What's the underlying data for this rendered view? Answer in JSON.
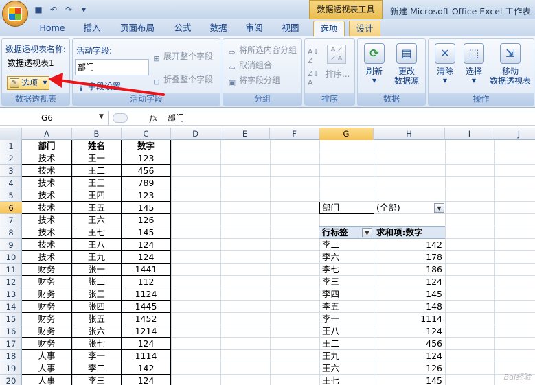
{
  "titlebar": {
    "context_tool": "数据透视表工具",
    "window_title": "新建 Microsoft Office Excel 工作表 -"
  },
  "tabs": [
    "Home",
    "插入",
    "页面布局",
    "公式",
    "数据",
    "审阅",
    "视图",
    "选项",
    "设计"
  ],
  "active_tab": "选项",
  "ribbon": {
    "pivot_group": {
      "name_label": "数据透视表名称:",
      "name_value": "数据透视表1",
      "options_btn": "选项",
      "group_label": "数据透视表"
    },
    "active_field_group": {
      "label": "活动字段:",
      "value": "部门",
      "field_settings": "字段设置",
      "expand": "展开整个字段",
      "collapse": "折叠整个字段",
      "group_label": "活动字段"
    },
    "group_group": {
      "group_selection": "将所选内容分组",
      "ungroup": "取消组合",
      "group_field": "将字段分组",
      "group_label": "分组"
    },
    "sort_group": {
      "sort": "排序...",
      "group_label": "排序"
    },
    "data_group": {
      "refresh": "刷新",
      "change_source_1": "更改",
      "change_source_2": "数据源",
      "group_label": "数据"
    },
    "actions_group": {
      "clear": "清除",
      "select": "选择",
      "move_1": "移动",
      "move_2": "数据透视表",
      "group_label": "操作"
    }
  },
  "formula_bar": {
    "cell_ref": "G6",
    "fx": "fx",
    "value": "部门"
  },
  "grid": {
    "columns": [
      "A",
      "B",
      "C",
      "D",
      "E",
      "F",
      "G",
      "H",
      "I",
      "J"
    ],
    "rows": [
      "1",
      "2",
      "3",
      "4",
      "5",
      "6",
      "7",
      "8",
      "9",
      "10",
      "11",
      "12",
      "13",
      "14",
      "15",
      "16",
      "17",
      "18",
      "19",
      "20"
    ],
    "source_header": [
      "部门",
      "姓名",
      "数字"
    ],
    "source_rows": [
      [
        "技术",
        "王一",
        "123"
      ],
      [
        "技术",
        "王二",
        "456"
      ],
      [
        "技术",
        "王三",
        "789"
      ],
      [
        "技术",
        "王四",
        "123"
      ],
      [
        "技术",
        "王五",
        "145"
      ],
      [
        "技术",
        "王六",
        "126"
      ],
      [
        "技术",
        "王七",
        "145"
      ],
      [
        "技术",
        "王八",
        "124"
      ],
      [
        "技术",
        "王九",
        "124"
      ],
      [
        "财务",
        "张一",
        "1441"
      ],
      [
        "财务",
        "张二",
        "112"
      ],
      [
        "财务",
        "张三",
        "1124"
      ],
      [
        "财务",
        "张四",
        "1445"
      ],
      [
        "财务",
        "张五",
        "1452"
      ],
      [
        "财务",
        "张六",
        "1214"
      ],
      [
        "财务",
        "张七",
        "124"
      ],
      [
        "人事",
        "李一",
        "1114"
      ],
      [
        "人事",
        "李二",
        "142"
      ],
      [
        "人事",
        "李三",
        "124"
      ]
    ],
    "pivot_filter_field": "部门",
    "pivot_filter_value": "(全部)",
    "pivot_row_label": "行标签",
    "pivot_value_label": "求和项:数字",
    "pivot_rows": [
      [
        "李二",
        "142"
      ],
      [
        "李六",
        "178"
      ],
      [
        "李七",
        "186"
      ],
      [
        "李三",
        "124"
      ],
      [
        "李四",
        "145"
      ],
      [
        "李五",
        "148"
      ],
      [
        "李一",
        "1114"
      ],
      [
        "王八",
        "124"
      ],
      [
        "王二",
        "456"
      ],
      [
        "王九",
        "124"
      ],
      [
        "王六",
        "126"
      ],
      [
        "王七",
        "145"
      ]
    ]
  }
}
